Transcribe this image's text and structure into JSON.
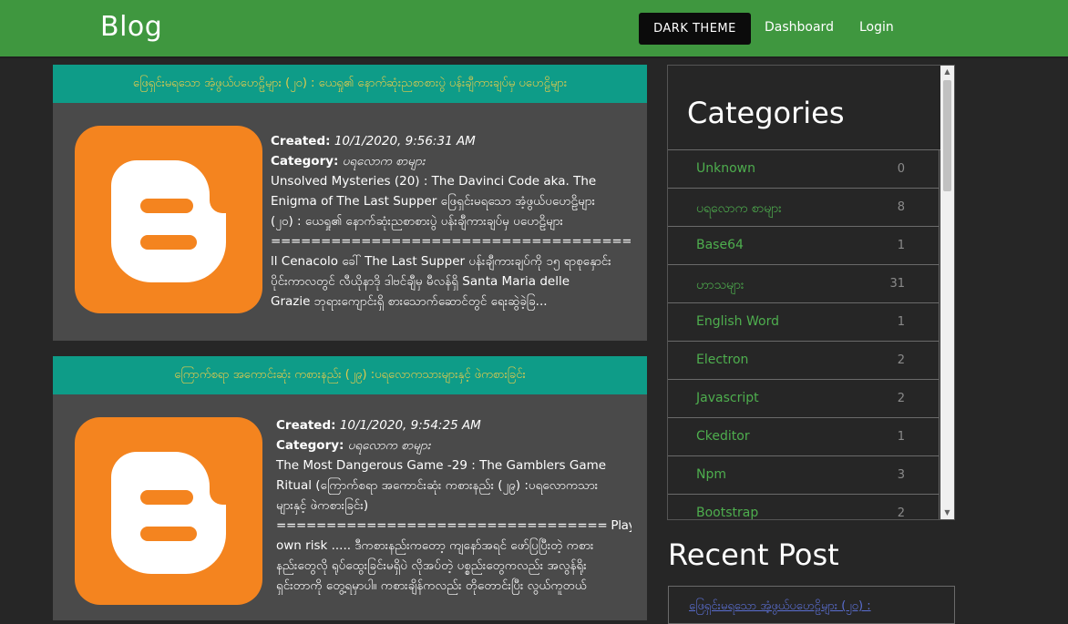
{
  "nav": {
    "brand": "Blog",
    "theme_button": "DARK THEME",
    "links": [
      "Dashboard",
      "Login"
    ]
  },
  "posts": [
    {
      "title": "ဖြေရှင်းမရသော အံ့ဖွယ်ပဟေဠိများ (၂၀) : ယေရှု၏ နောက်ဆုံးညစာစားပွဲ ပန်းချီကားချပ်မှ ပဟေဠိများ",
      "created_label": "Created:",
      "created_value": "10/1/2020, 9:56:31 AM",
      "category_label": "Category:",
      "category_value": "ပရလောက စာများ",
      "lines": [
        "Unsolved Mysteries (20) : The Davinci Code aka. The",
        "Enigma of The Last Supper ဖြေရှင်းမရသော အံ့ဖွယ်ပဟေဠိများ",
        "(၂၀) : ယေရှု၏ နောက်ဆုံးညစာစားပွဲ ပန်းချီကားချပ်မှ ပဟေဠိများ",
        "=============================================",
        "ll Cenacolo ခေါ် The Last Supper ပန်းချီကားချပ်ကို ၁၅ ရာစုနှောင်း",
        "ပိုင်းကာလတွင် လီယိုနာဒို ဒါဗင်ချီမှ မီလန်ရှိ Santa Maria delle",
        "Grazie ဘုရားကျောင်းရှိ စားသောက်ဆောင်တွင် ရေးဆွဲခဲ့ခြ..."
      ]
    },
    {
      "title": "ကြောက်စရာ အကောင်းဆုံး ကစားနည်း (၂၉) :ပရလောကသားများနှင့် ဖဲကစားခြင်း",
      "created_label": "Created:",
      "created_value": "10/1/2020, 9:54:25 AM",
      "category_label": "Category:",
      "category_value": "ပရလောက စာများ",
      "lines": [
        "The Most Dangerous Game -29 : The Gamblers Game",
        "Ritual (ကြောက်စရာ အကောင်းဆုံး ကစားနည်း (၂၉) :ပရလောကသား",
        "များနှင့် ဖဲကစားခြင်း)",
        "================================= Play at your",
        "own risk ..... ဒီကစားနည်းကတော့ ကျနော်အရင် ဖော်ပြပြီးတဲ့ ကစား",
        "နည်းတွေလို ရုပ်ထွေးခြင်းမရှိပဲ လိုအပ်တဲ့ ပစ္စည်းတွေကလည်း အလွန်ရိုး",
        "ရှင်းတာကို တွေ့ရမှာပါ။ ကစားချိန်ကလည်း တိုတောင်းပြီး လွယ်ကူတယ်"
      ]
    }
  ],
  "sidebar": {
    "heading": "Categories",
    "categories": [
      {
        "name": "Unknown",
        "count": "0"
      },
      {
        "name": "ပရလောက စာများ",
        "count": "8"
      },
      {
        "name": "Base64",
        "count": "1"
      },
      {
        "name": "ဟာသများ",
        "count": "31"
      },
      {
        "name": "English Word",
        "count": "1"
      },
      {
        "name": "Electron",
        "count": "2"
      },
      {
        "name": "Javascript",
        "count": "2"
      },
      {
        "name": "Ckeditor",
        "count": "1"
      },
      {
        "name": "Npm",
        "count": "3"
      },
      {
        "name": "Bootstrap",
        "count": "2"
      }
    ]
  },
  "recent": {
    "heading": "Recent Post",
    "first_item": "ဖြေရှင်းမရသော အံ့ဖွယ်ပဟေဠိများ (၂၀) :"
  },
  "colors": {
    "header": "#3f973f",
    "post_title_bg": "#0e9c88",
    "post_title_text": "#e3ca4c",
    "category_link": "#4eae4e",
    "blogger_orange": "#f4841f"
  }
}
